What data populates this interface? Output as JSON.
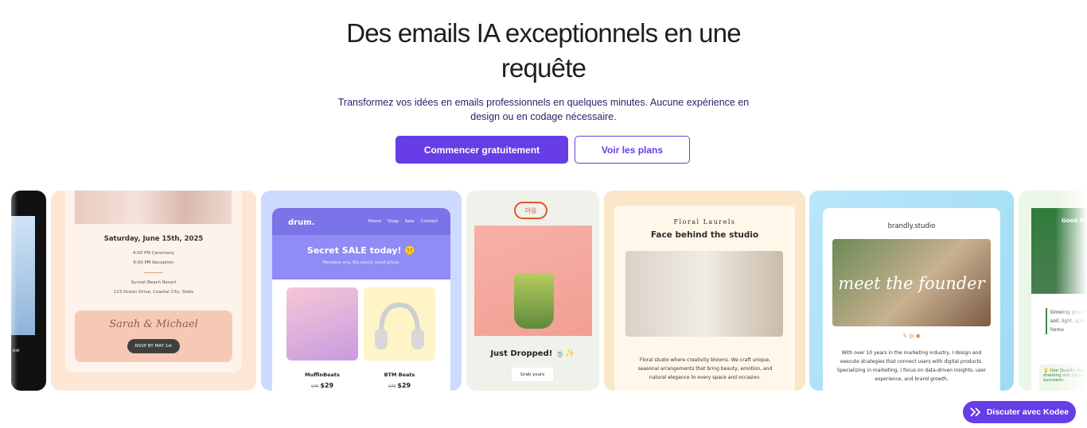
{
  "hero": {
    "title": "Des emails IA exceptionnels en une requête",
    "subtitle": "Transformez vos idées en emails professionnels en quelques minutes. Aucune expérience en design ou en codage nécessaire.",
    "cta_primary": "Commencer gratuitement",
    "cta_secondary": "Voir les plans"
  },
  "templates": {
    "dark_partial": {
      "label": "ew"
    },
    "wedding": {
      "date": "Saturday, June 15th, 2025",
      "ceremony": "4:00 PM Ceremony",
      "reception": "6:00 PM Reception",
      "venue": "Sunset Beach Resort",
      "address": "123 Ocean Drive, Coastal City, State",
      "names": "Sarah & Michael",
      "rsvp": "RSVP BY MAY 1st"
    },
    "drum": {
      "brand": "drum.",
      "nav": [
        "Home",
        "Shop",
        "Sale",
        "Contact"
      ],
      "headline": "Secret SALE today! 🤫",
      "sub": "Members only. Big sound, small prices.",
      "products": [
        {
          "name": "MuffinBeats",
          "old": "$79",
          "price": "$29"
        },
        {
          "name": "BTM Beats",
          "old": "$79",
          "price": "$29"
        }
      ]
    },
    "matcha": {
      "stamp": "야옹",
      "headline": "Just Dropped! 🍵✨",
      "cta": "Grab yours"
    },
    "floral": {
      "brand": "Floral Laurels",
      "title": "Face behind the studio",
      "body": "Floral studio where creativity blooms. We craft unique, seasonal arrangements that bring beauty, emotion, and natural elegance to every space and occasion."
    },
    "brandly": {
      "brand": "brandly.studio",
      "overlay": "meet the founder",
      "icons": "𝕏   ◎   ◉",
      "body": "With over 10 years in the marketing industry, I design and execute strategies that connect users with digital products. Specializing in marketing, I focus on data-driven insights, user experience, and brand growth."
    },
    "green_partial": {
      "title": "Good N",
      "body": "Growing your right soil, light, space at home",
      "tip": "💡 Use Quality Well-draining soil container succeeds"
    }
  },
  "chat": {
    "label": "Discuter avec Kodee"
  },
  "colors": {
    "accent": "#673de6",
    "text": "#1d1e20"
  }
}
